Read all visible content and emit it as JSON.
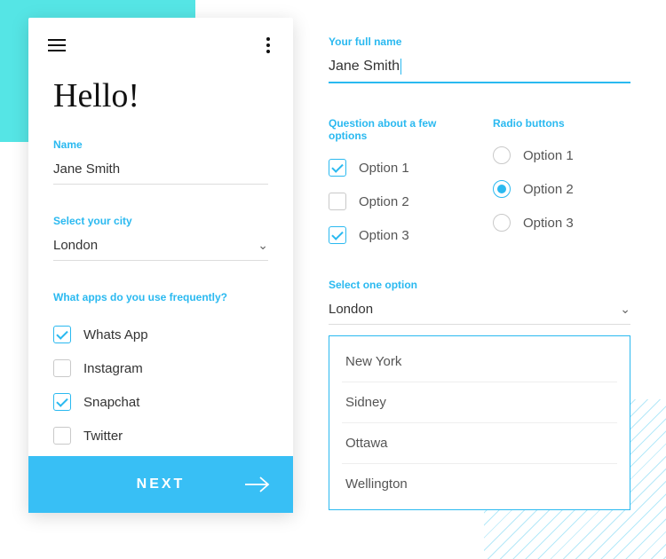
{
  "card": {
    "greeting": "Hello!",
    "name_label": "Name",
    "name_value": "Jane Smith",
    "city_label": "Select your city",
    "city_value": "London",
    "apps_label": "What apps do you use frequently?",
    "apps": [
      {
        "label": "Whats App",
        "checked": true
      },
      {
        "label": "Instagram",
        "checked": false
      },
      {
        "label": "Snapchat",
        "checked": true
      },
      {
        "label": "Twitter",
        "checked": false
      }
    ],
    "next_label": "NEXT"
  },
  "panel": {
    "fullname_label": "Your full name",
    "fullname_value": "Jane Smith",
    "checkbox_label": "Question about a few options",
    "checkbox_options": [
      {
        "label": "Option 1",
        "checked": true
      },
      {
        "label": "Option 2",
        "checked": false
      },
      {
        "label": "Option 3",
        "checked": true
      }
    ],
    "radio_label": "Radio buttons",
    "radio_options": [
      {
        "label": "Option 1",
        "selected": false
      },
      {
        "label": "Option 2",
        "selected": true
      },
      {
        "label": "Option 3",
        "selected": false
      }
    ],
    "select_label": "Select one option",
    "select_value": "London",
    "dropdown_items": [
      "New York",
      "Sidney",
      "Ottawa",
      "Wellington"
    ]
  }
}
